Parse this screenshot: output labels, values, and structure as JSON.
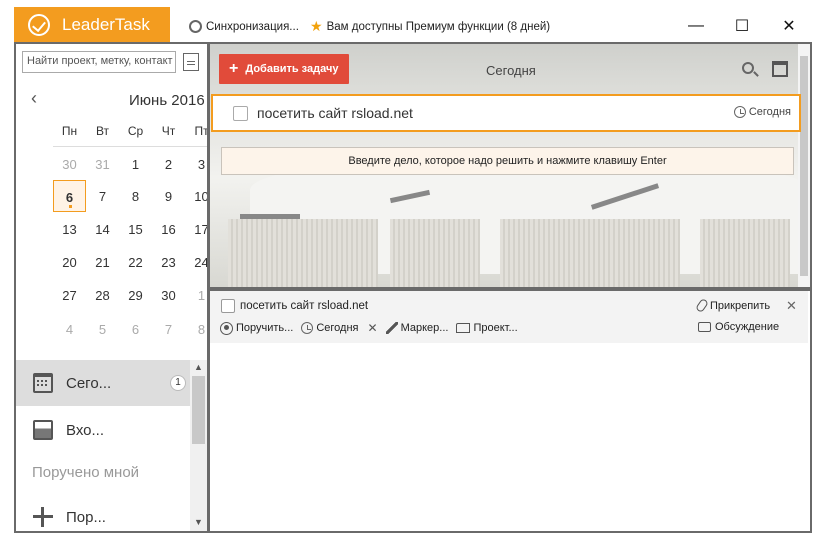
{
  "titlebar": {
    "app_name": "LeaderTask",
    "sync_label": "Синхронизация...",
    "premium_label": "Вам доступны Премиум функции (8 дней)",
    "minimize": "—",
    "maximize": "☐",
    "close": "✕",
    "brand_color": "#f39c1f"
  },
  "sidebar": {
    "search_placeholder": "Найти проект, метку, контакт",
    "calendar": {
      "prev": "‹",
      "title": "Июнь 2016",
      "weekdays": [
        "Пн",
        "Вт",
        "Ср",
        "Чт",
        "Пт"
      ],
      "weeks": [
        [
          "30",
          "31",
          "1",
          "2",
          "3"
        ],
        [
          "6",
          "7",
          "8",
          "9",
          "10"
        ],
        [
          "13",
          "14",
          "15",
          "16",
          "17"
        ],
        [
          "20",
          "21",
          "22",
          "23",
          "24"
        ],
        [
          "27",
          "28",
          "29",
          "30",
          "1"
        ],
        [
          "4",
          "5",
          "6",
          "7",
          "8"
        ]
      ],
      "selected_day": "6"
    },
    "items": [
      {
        "label": "Сего...",
        "icon": "calendar-icon",
        "badge": "1"
      },
      {
        "label": "Вхо...",
        "icon": "inbox-icon"
      },
      {
        "label": "Пор...",
        "icon": "plus-icon"
      }
    ],
    "section_header": "Поручено мной",
    "scroll_up": "▲",
    "scroll_down": "▼"
  },
  "toolbar": {
    "add_label": "Добавить задачу",
    "add_plus": "+",
    "title": "Сегодня",
    "accent_color": "#e14b3a"
  },
  "task": {
    "title": "посетить сайт rsload.net",
    "date": "Сегодня"
  },
  "hint": "Введите дело, которое надо решить и нажмите клавишу Enter",
  "details": {
    "title": "посетить сайт rsload.net",
    "attach": "Прикрепить",
    "close": "✕",
    "assign": "Поручить...",
    "date": "Сегодня",
    "date_clear": "✕",
    "marker": "Маркер...",
    "project": "Проект...",
    "discussion": "Обсуждение"
  }
}
